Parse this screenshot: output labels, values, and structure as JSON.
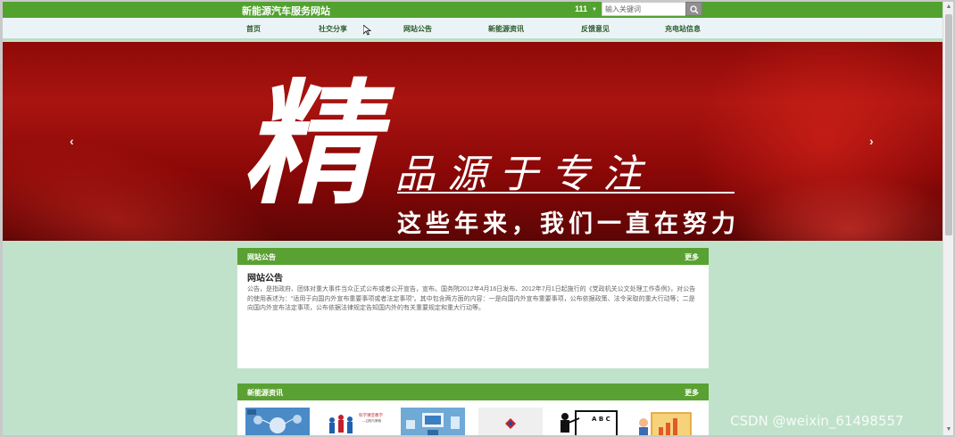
{
  "header": {
    "site_title": "新能源汽车服务网站",
    "username": "111",
    "search_placeholder": "输入关键词"
  },
  "nav": {
    "items": [
      {
        "label": "首页"
      },
      {
        "label": "社交分享"
      },
      {
        "label": "网站公告"
      },
      {
        "label": "新能源资讯"
      },
      {
        "label": "反馈意见"
      },
      {
        "label": "充电站信息"
      }
    ]
  },
  "banner": {
    "big_char": "精",
    "slogan": "品源于专注",
    "subline": "这些年来，我们一直在努力",
    "prev": "‹",
    "next": "›"
  },
  "notice_panel": {
    "header": "网站公告",
    "more": "更多",
    "title": "网站公告",
    "body": "公告，是指政府、团体对重大事件当众正式公布或者公开宣告，宣布。国务院2012年4月16日发布、2012年7月1日起施行的《党政机关公文处理工作条例》，对公告的使用表述为：“适用于向国内外宣布重要事项或者法定事项”。其中包含两方面的内容：一是向国内外宣布重要事项，公布依据政策、法令采取的重大行动等；二是向国内外宣布法定事项，公布依据法律规定告知国内外的有关重要规定和重大行动等。"
  },
  "news_panel": {
    "header": "新能源资讯",
    "more": "更多",
    "thumbnails": [
      {
        "icon": "tech-network-thumb"
      },
      {
        "icon": "people-growth-thumb",
        "caption": "科学课堂教学 —过程与策略"
      },
      {
        "icon": "data-devices-thumb"
      },
      {
        "icon": "logo-thumb"
      },
      {
        "icon": "teacher-board-thumb",
        "caption": "A B C"
      },
      {
        "icon": "presentation-chart-thumb"
      }
    ]
  },
  "watermark": "CSDN @weixin_61498557",
  "colors": {
    "topbar": "#52a22f",
    "panel_header": "#5aa133",
    "page_bg": "#c0e2cb",
    "banner": "#a91410"
  }
}
